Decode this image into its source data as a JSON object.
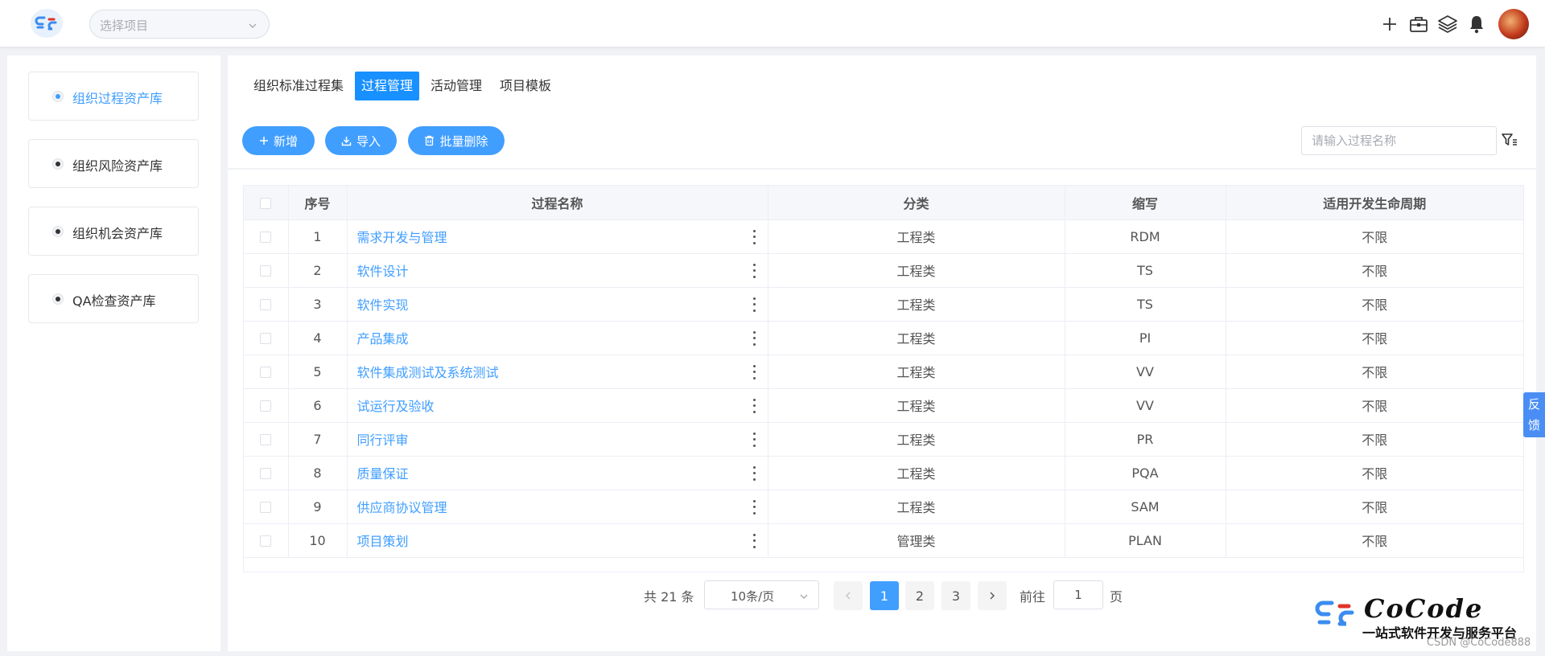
{
  "header": {
    "project_placeholder": "选择项目",
    "icons": [
      "plus-icon",
      "toolbox-icon",
      "layers-icon",
      "bell-icon",
      "user-avatar"
    ]
  },
  "sidebar": {
    "items": [
      {
        "label": "组织过程资产库",
        "active": true
      },
      {
        "label": "组织风险资产库",
        "active": false
      },
      {
        "label": "组织机会资产库",
        "active": false
      },
      {
        "label": "QA检查资产库",
        "active": false
      }
    ]
  },
  "tabs": [
    {
      "label": "组织标准过程集",
      "active": false
    },
    {
      "label": "过程管理",
      "active": true
    },
    {
      "label": "活动管理",
      "active": false
    },
    {
      "label": "项目模板",
      "active": false
    }
  ],
  "toolbar": {
    "add_label": "新增",
    "import_label": "导入",
    "batch_delete_label": "批量删除",
    "search_placeholder": "请输入过程名称"
  },
  "table": {
    "columns": [
      "序号",
      "过程名称",
      "分类",
      "缩写",
      "适用开发生命周期"
    ],
    "rows": [
      {
        "no": "1",
        "name": "需求开发与管理",
        "category": "工程类",
        "abbr": "RDM",
        "lifecycle": "不限"
      },
      {
        "no": "2",
        "name": "软件设计",
        "category": "工程类",
        "abbr": "TS",
        "lifecycle": "不限"
      },
      {
        "no": "3",
        "name": "软件实现",
        "category": "工程类",
        "abbr": "TS",
        "lifecycle": "不限"
      },
      {
        "no": "4",
        "name": "产品集成",
        "category": "工程类",
        "abbr": "PI",
        "lifecycle": "不限"
      },
      {
        "no": "5",
        "name": "软件集成测试及系统测试",
        "category": "工程类",
        "abbr": "VV",
        "lifecycle": "不限"
      },
      {
        "no": "6",
        "name": "试运行及验收",
        "category": "工程类",
        "abbr": "VV",
        "lifecycle": "不限"
      },
      {
        "no": "7",
        "name": "同行评审",
        "category": "工程类",
        "abbr": "PR",
        "lifecycle": "不限"
      },
      {
        "no": "8",
        "name": "质量保证",
        "category": "工程类",
        "abbr": "PQA",
        "lifecycle": "不限"
      },
      {
        "no": "9",
        "name": "供应商协议管理",
        "category": "工程类",
        "abbr": "SAM",
        "lifecycle": "不限"
      },
      {
        "no": "10",
        "name": "项目策划",
        "category": "管理类",
        "abbr": "PLAN",
        "lifecycle": "不限"
      }
    ]
  },
  "pagination": {
    "total_text": "共 21 条",
    "page_size": "10条/页",
    "pages": [
      "1",
      "2",
      "3"
    ],
    "current_page": "1",
    "goto_label": "前往",
    "goto_value": "1",
    "page_label": "页"
  },
  "feedback": {
    "char1": "反",
    "char2": "馈"
  },
  "watermark": {
    "brand": "CoCode",
    "tagline": "一站式软件开发与服务平台",
    "credit": "CSDN @CoCode888"
  },
  "colors": {
    "primary": "#409eff",
    "tab_active": "#1890ff",
    "feedback": "#4a8ef5"
  }
}
